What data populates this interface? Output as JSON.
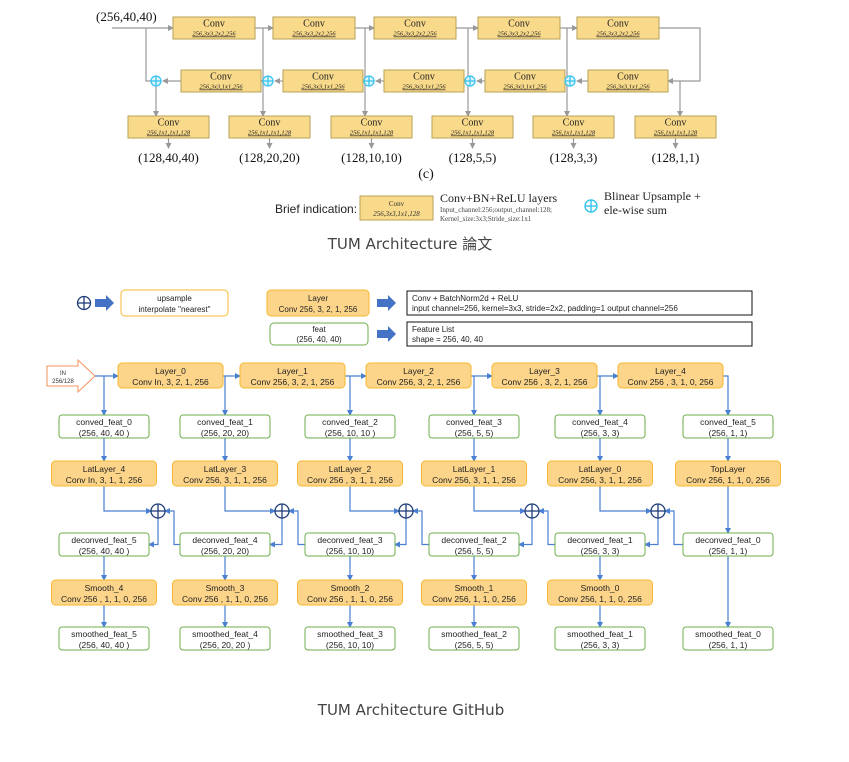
{
  "colors": {
    "paper_box_fill": "#f9d98a",
    "paper_box_stroke": "#b8a25a",
    "paper_line": "#999999",
    "paper_plus": "#36c3ee",
    "gh_layer_fill": "#fdd58a",
    "gh_layer_stroke": "#f5b82e",
    "gh_feat_stroke": "#6eae4c",
    "gh_line": "#4a7fd1",
    "gh_plus": "#1f3d7a",
    "gh_in_stroke": "#f0935b",
    "gh_arrow": "#4472c4"
  },
  "paper": {
    "input_label": "(256,40,40)",
    "top_row": [
      {
        "title": "Conv",
        "params": "256,3x3,2x2,256"
      },
      {
        "title": "Conv",
        "params": "256,3x3,2x2,256"
      },
      {
        "title": "Conv",
        "params": "256,3x3,2x2,256"
      },
      {
        "title": "Conv",
        "params": "256,3x3,2x2,256"
      },
      {
        "title": "Conv",
        "params": "256,3x3,2x2,256"
      }
    ],
    "mid_row": [
      {
        "title": "Conv",
        "params": "256,3x3,1x1,256"
      },
      {
        "title": "Conv",
        "params": "256,3x3,1x1,256"
      },
      {
        "title": "Conv",
        "params": "256,3x3,1x1,256"
      },
      {
        "title": "Conv",
        "params": "256,3x3,1x1,256"
      },
      {
        "title": "Conv",
        "params": "256,3x3,1x1,256"
      }
    ],
    "bottom_row": [
      {
        "title": "Conv",
        "params": "256,1x1,1x1,128"
      },
      {
        "title": "Conv",
        "params": "256,1x1,1x1,128"
      },
      {
        "title": "Conv",
        "params": "256,1x1,1x1,128"
      },
      {
        "title": "Conv",
        "params": "256,1x1,1x1,128"
      },
      {
        "title": "Conv",
        "params": "256,1x1,1x1,128"
      },
      {
        "title": "Conv",
        "params": "256,1x1,1x1,128"
      }
    ],
    "outputs": [
      "(128,40,40)",
      "(128,20,20)",
      "(128,10,10)",
      "(128,5,5)",
      "(128,3,3)",
      "(128,1,1)"
    ],
    "subfigure_label": "(c)",
    "legend": {
      "label": "Brief indication:",
      "box_title": "Conv",
      "box_params": "256,3x3,1x1,128",
      "conv_title": "Conv+BN+ReLU layers",
      "conv_desc_1": "Input_channel:256;output_channel:128;",
      "conv_desc_2": "Kernel_size:3x3;Stride_size:1x1",
      "plus_line_1": "Blinear Upsample +",
      "plus_line_2": "ele-wise sum"
    },
    "caption": "TUM Architecture 論文"
  },
  "github": {
    "legend": {
      "upsample_line_1": "upsample",
      "upsample_line_2": "interpolate \"nearest\"",
      "layer_title": "Layer",
      "layer_params": "Conv 256, 3, 2, 1, 256",
      "layer_desc_1": "Conv + BatchNorm2d +  ReLU",
      "layer_desc_2": "input channel=256, kernel=3x3, stride=2x2, padding=1 output channel=256",
      "feat_title": "feat",
      "feat_shape": "(256, 40, 40)",
      "feat_desc_1": "Feature List",
      "feat_desc_2": "shape = 256,  40, 40"
    },
    "input": {
      "line_1": "IN",
      "line_2": "256/128"
    },
    "layers": [
      {
        "title": "Layer_0",
        "params": "Conv In, 3, 2, 1, 256"
      },
      {
        "title": "Layer_1",
        "params": "Conv 256, 3, 2, 1, 256"
      },
      {
        "title": "Layer_2",
        "params": "Conv 256, 3, 2, 1, 256"
      },
      {
        "title": "Layer_3",
        "params": "Conv 256 , 3, 2, 1, 256"
      },
      {
        "title": "Layer_4",
        "params": "Conv 256 , 3, 1, 0, 256"
      }
    ],
    "conved": [
      {
        "name": "conved_feat_0",
        "shape": "(256, 40, 40 )"
      },
      {
        "name": "conved_feat_1",
        "shape": "(256, 20, 20)"
      },
      {
        "name": "conved_feat_2",
        "shape": "(256, 10, 10 )"
      },
      {
        "name": "conved_feat_3",
        "shape": "(256, 5, 5)"
      },
      {
        "name": "conved_feat_4",
        "shape": "(256, 3, 3)"
      },
      {
        "name": "conved_feat_5",
        "shape": "(256, 1,  1)"
      }
    ],
    "lat": [
      {
        "title": "LatLayer_4",
        "params": "Conv In,  3, 1, 1, 256"
      },
      {
        "title": "LatLayer_3",
        "params": "Conv 256, 3, 1, 1, 256"
      },
      {
        "title": "LatLayer_2",
        "params": "Conv 256 , 3, 1, 1, 256"
      },
      {
        "title": "LatLayer_1",
        "params": "Conv 256, 3,  1, 1, 256"
      },
      {
        "title": "LatLayer_0",
        "params": "Conv 256, 3,  1, 1, 256"
      },
      {
        "title": "TopLayer",
        "params": "Conv 256, 1, 1, 0, 256"
      }
    ],
    "deconved": [
      {
        "name": "deconved_feat_5",
        "shape": "(256, 40, 40 )"
      },
      {
        "name": "deconved_feat_4",
        "shape": "(256, 20, 20)"
      },
      {
        "name": "deconved_feat_3",
        "shape": "(256, 10, 10)"
      },
      {
        "name": "deconved_feat_2",
        "shape": "(256, 5, 5)"
      },
      {
        "name": "deconved_feat_1",
        "shape": "(256, 3, 3)"
      },
      {
        "name": "deconved_feat_0",
        "shape": "(256, 1,  1)"
      }
    ],
    "smooth": [
      {
        "title": "Smooth_4",
        "params": "Conv 256 , 1,  1, 0,  256"
      },
      {
        "title": "Smooth_3",
        "params": "Conv  256 , 1,  1,  0,  256"
      },
      {
        "title": "Smooth_2",
        "params": "Conv 256 , 1,  1, 0,  256"
      },
      {
        "title": "Smooth_1",
        "params": "Conv 256, 1,  1, 0,  256"
      },
      {
        "title": "Smooth_0",
        "params": "Conv 256, 1, 1, 0, 256"
      }
    ],
    "smoothed": [
      {
        "name": "smoothed_feat_5",
        "shape": "(256, 40, 40 )"
      },
      {
        "name": "smoothed_feat_4",
        "shape": "(256, 20, 20 )"
      },
      {
        "name": "smoothed_feat_3",
        "shape": "(256, 10, 10)"
      },
      {
        "name": "smoothed_feat_2",
        "shape": "(256,  5, 5)"
      },
      {
        "name": "smoothed_feat_1",
        "shape": "(256, 3, 3)"
      },
      {
        "name": "smoothed_feat_0",
        "shape": "(256, 1,  1)"
      }
    ],
    "caption": "TUM Architecture GitHub"
  }
}
